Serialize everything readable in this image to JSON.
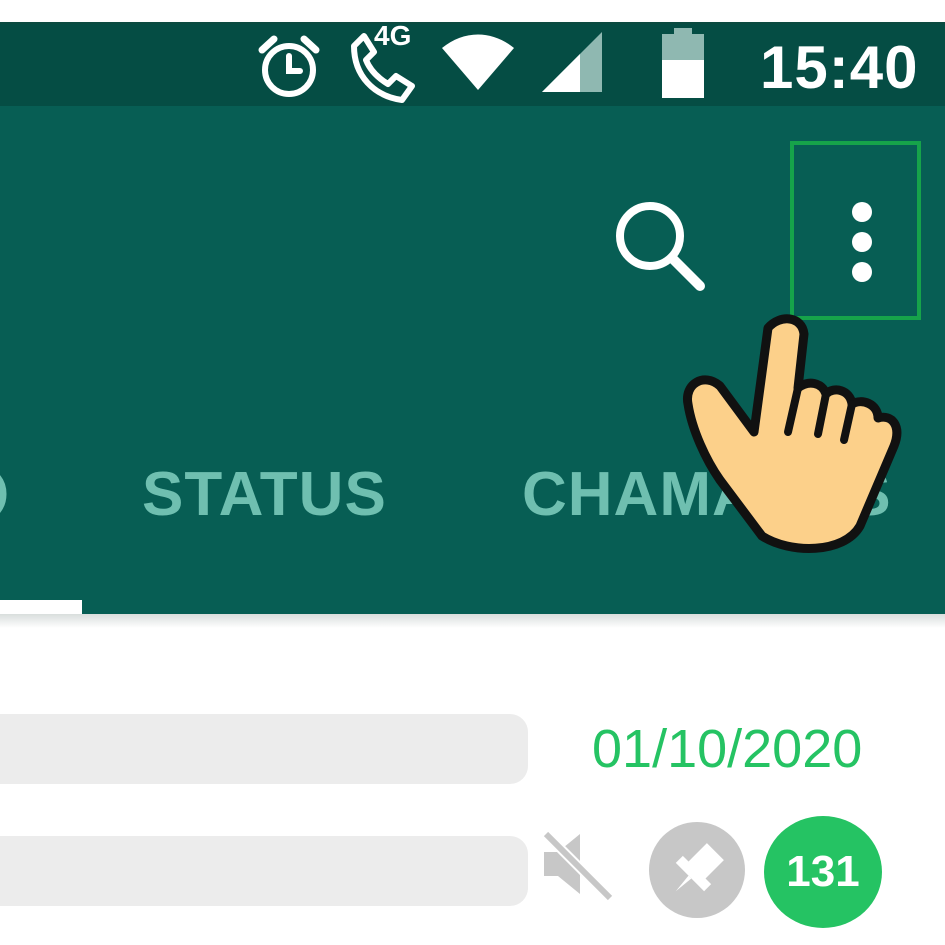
{
  "status_bar": {
    "time": "15:40",
    "network_label": "4G",
    "icons": [
      "alarm-icon",
      "wifi-call-icon",
      "wifi-icon",
      "signal-icon",
      "battery-icon"
    ]
  },
  "toolbar": {
    "icons": [
      "search-icon",
      "more-options-icon"
    ]
  },
  "tabs": [
    {
      "label": "STATUS"
    },
    {
      "label": "CHAMADAS"
    }
  ],
  "chat": {
    "date": "01/10/2020",
    "unread_count": "131",
    "icons": [
      "mute-icon",
      "pin-icon"
    ]
  },
  "overlay": {
    "pointer": "pointing-hand-icon",
    "highlight_color": "#16a34a"
  },
  "colors": {
    "status_bar": "#054d44",
    "app_bar": "#075e54",
    "tab_text": "#6fbfb0",
    "accent_green": "#25c363",
    "placeholder": "#ececec"
  }
}
